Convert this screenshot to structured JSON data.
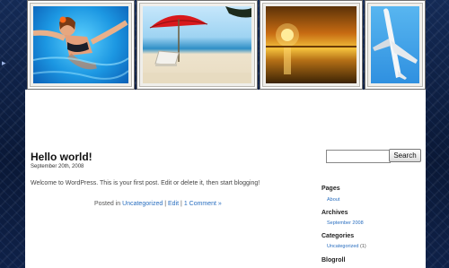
{
  "header": {
    "photos": [
      {
        "alt": "woman in swimming pool"
      },
      {
        "alt": "red umbrella and lounge chair on beach"
      },
      {
        "alt": "sunset over the sea"
      },
      {
        "alt": "airplane in blue sky"
      }
    ]
  },
  "post": {
    "title": "Hello world!",
    "date": "September 20th, 2008",
    "body": "Welcome to WordPress. This is your first post. Edit or delete it, then start blogging!",
    "meta_prefix": "Posted in",
    "category": "Uncategorized",
    "separator": "|",
    "edit_label": "Edit",
    "comments_label": "1 Comment »"
  },
  "sidebar": {
    "search_placeholder": "",
    "search_button": "Search",
    "pages_title": "Pages",
    "pages_items": [
      "About"
    ],
    "archives_title": "Archives",
    "archives_items": [
      "September 2008"
    ],
    "categories_title": "Categories",
    "categories_items": [
      {
        "label": "Uncategorized",
        "count": "(1)"
      }
    ],
    "blogroll_title": "Blogroll"
  },
  "colors": {
    "background": "#0c1c3d",
    "link": "#2a6fc0",
    "content": "#ffffff"
  }
}
